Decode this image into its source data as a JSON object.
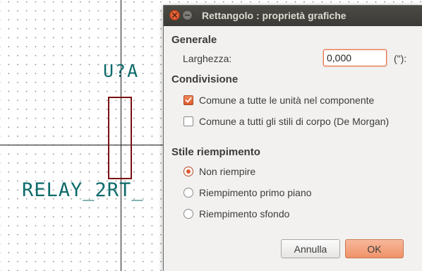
{
  "schematic": {
    "reference": "U?A",
    "value": "RELAY_2RT_"
  },
  "dialog": {
    "title": "Rettangolo : proprietà grafiche",
    "general": {
      "heading": "Generale",
      "width_label": "Larghezza:",
      "width_value": "0,000",
      "unit": "(\"):"
    },
    "sharing": {
      "heading": "Condivisione",
      "options": [
        {
          "label": "Comune a tutte le unità nel componente",
          "checked": true
        },
        {
          "label": "Comune a tutti gli stili di corpo (De Morgan)",
          "checked": false
        }
      ]
    },
    "fill": {
      "heading": "Stile riempimento",
      "options": [
        {
          "label": "Non riempire",
          "selected": true
        },
        {
          "label": "Riempimento primo piano",
          "selected": false
        },
        {
          "label": "Riempimento sfondo",
          "selected": false
        }
      ]
    },
    "buttons": {
      "cancel": "Annulla",
      "ok": "OK"
    }
  }
}
